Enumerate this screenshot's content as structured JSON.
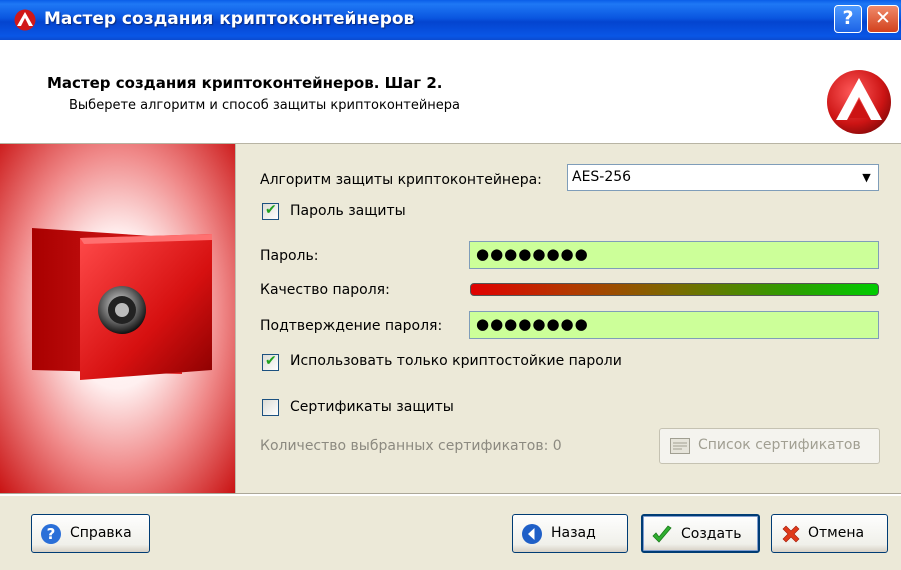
{
  "window": {
    "title": "Мастер создания криптоконтейнеров",
    "help_glyph": "?",
    "close_glyph": "✕"
  },
  "header": {
    "title": "Мастер создания криптоконтейнеров. Шаг 2.",
    "subtitle": "Выберете алгоритм и способ защиты криптоконтейнера"
  },
  "form": {
    "algorithm_label": "Алгоритм защиты криптоконтейнера:",
    "algorithm_value": "AES-256",
    "password_protection_label": "Пароль защиты",
    "password_protection_checked": true,
    "password_label": "Пароль:",
    "password_value": "●●●●●●●●",
    "quality_label": "Качество пароля:",
    "quality_level": 1.0,
    "confirm_label": "Подтверждение пароля:",
    "confirm_value": "●●●●●●●●",
    "strong_only_label": "Использовать только криптостойкие пароли",
    "strong_only_checked": true,
    "certificates_label": "Сертификаты защиты",
    "certificates_checked": false,
    "selected_certs_label": "Количество выбранных сертификатов: 0",
    "cert_list_button": "Список сертификатов"
  },
  "footer": {
    "help_button": "Справка",
    "back_button": "Назад",
    "create_button": "Создать",
    "cancel_button": "Отмена"
  },
  "colors": {
    "field_bg": "#ccff99",
    "titlebar": "#0a56e0",
    "brand_red": "#cc1414"
  },
  "icons": {
    "app_logo": "red-triangle-logo-icon",
    "safe": "safe-image",
    "help": "question-icon",
    "back": "back-arrow-icon",
    "create": "checkmark-icon",
    "cancel": "red-x-icon",
    "cert_list": "certificate-list-icon"
  }
}
